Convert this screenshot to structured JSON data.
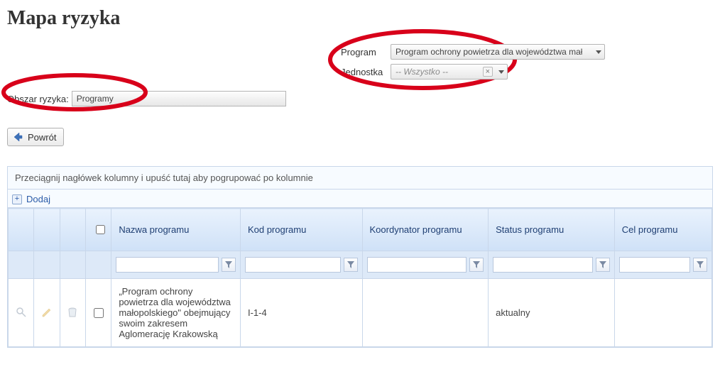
{
  "page_title": "Mapa ryzyka",
  "filters": {
    "program_label": "Program",
    "program_value": "Program ochrony powietrza dla województwa mał",
    "jednostka_label": "Jednostka",
    "jednostka_placeholder": "-- Wszystko --",
    "obszar_label": "Obszar ryzyka:",
    "obszar_value": "Programy"
  },
  "back_label": "Powrót",
  "grid": {
    "group_hint": "Przeciągnij nagłówek kolumny i upuść tutaj aby pogrupować po kolumnie",
    "add_label": "Dodaj",
    "columns": {
      "nazwa": "Nazwa programu",
      "kod": "Kod programu",
      "koordynator": "Koordynator programu",
      "status": "Status programu",
      "cel": "Cel programu"
    },
    "rows": [
      {
        "nazwa": "„Program ochrony powietrza dla województwa małopolskiego\" obejmujący swoim zakresem Aglomerację Krakowską",
        "kod": "I-1-4",
        "koordynator": "",
        "status": "aktualny",
        "cel": ""
      }
    ]
  }
}
